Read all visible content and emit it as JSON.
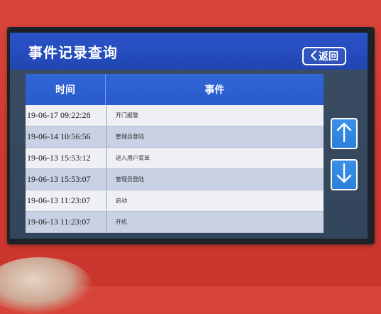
{
  "screen": {
    "title": "事件记录查询",
    "back_label": "返回",
    "colors": {
      "header": "#2146b3",
      "row_odd": "#eef0f4",
      "row_even": "#c9d2e4",
      "arrow_button": "#2a7fd9",
      "device_body": "#d0392f"
    }
  },
  "table": {
    "headers": [
      "时间",
      "事件"
    ],
    "rows": [
      {
        "time": "19-06-17  09:22:28",
        "event": "开门报警"
      },
      {
        "time": "19-06-14  10:56:56",
        "event": "管理员登陆"
      },
      {
        "time": "19-06-13  15:53:12",
        "event": "进入用户菜单"
      },
      {
        "time": "19-06-13  15:53:07",
        "event": "管理员登陆"
      },
      {
        "time": "19-06-13  11:23:07",
        "event": "启动"
      },
      {
        "time": "19-06-13  11:23:07",
        "event": "开机"
      }
    ]
  },
  "controls": {
    "scroll_up_icon": "arrow-up-icon",
    "scroll_down_icon": "arrow-down-icon"
  }
}
